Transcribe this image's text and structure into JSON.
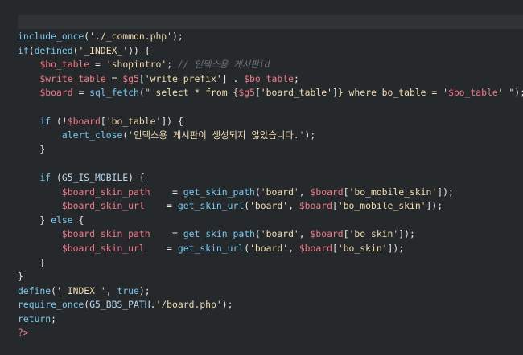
{
  "editor": {
    "lines": [
      [
        {
          "t": "include_once",
          "c": "fn"
        },
        {
          "t": "(",
          "c": "op"
        },
        {
          "t": "'./_common.php'",
          "c": "str"
        },
        {
          "t": ");",
          "c": "op"
        }
      ],
      [
        {
          "t": "if",
          "c": "kw"
        },
        {
          "t": "(",
          "c": "op"
        },
        {
          "t": "defined",
          "c": "fn"
        },
        {
          "t": "(",
          "c": "op"
        },
        {
          "t": "'_INDEX_'",
          "c": "str"
        },
        {
          "t": ")) {",
          "c": "op"
        }
      ],
      [
        {
          "t": "    ",
          "c": "op"
        },
        {
          "t": "$bo_table",
          "c": "var"
        },
        {
          "t": " = ",
          "c": "op"
        },
        {
          "t": "'shopintro'",
          "c": "str"
        },
        {
          "t": "; ",
          "c": "op"
        },
        {
          "t": "// 인덱스용 게시판id",
          "c": "cmt"
        }
      ],
      [
        {
          "t": "    ",
          "c": "op"
        },
        {
          "t": "$write_table",
          "c": "var"
        },
        {
          "t": " = ",
          "c": "op"
        },
        {
          "t": "$g5",
          "c": "var"
        },
        {
          "t": "[",
          "c": "op"
        },
        {
          "t": "'write_prefix'",
          "c": "str"
        },
        {
          "t": "] . ",
          "c": "op"
        },
        {
          "t": "$bo_table",
          "c": "var"
        },
        {
          "t": ";",
          "c": "op"
        }
      ],
      [
        {
          "t": "    ",
          "c": "op"
        },
        {
          "t": "$board",
          "c": "var"
        },
        {
          "t": " = ",
          "c": "op"
        },
        {
          "t": "sql_fetch",
          "c": "fn"
        },
        {
          "t": "(",
          "c": "op"
        },
        {
          "t": "\" select * from {",
          "c": "str"
        },
        {
          "t": "$g5",
          "c": "var"
        },
        {
          "t": "[",
          "c": "op"
        },
        {
          "t": "'board_table'",
          "c": "str"
        },
        {
          "t": "]",
          "c": "op"
        },
        {
          "t": "} where bo_table = '",
          "c": "str"
        },
        {
          "t": "$bo_table",
          "c": "var"
        },
        {
          "t": "' \"",
          "c": "str"
        },
        {
          "t": ");",
          "c": "op"
        }
      ],
      [
        {
          "t": "",
          "c": "op"
        }
      ],
      [
        {
          "t": "    ",
          "c": "op"
        },
        {
          "t": "if",
          "c": "kw"
        },
        {
          "t": " (!",
          "c": "op"
        },
        {
          "t": "$board",
          "c": "var"
        },
        {
          "t": "[",
          "c": "op"
        },
        {
          "t": "'bo_table'",
          "c": "str"
        },
        {
          "t": "]) {",
          "c": "op"
        }
      ],
      [
        {
          "t": "        ",
          "c": "op"
        },
        {
          "t": "alert_close",
          "c": "fn"
        },
        {
          "t": "(",
          "c": "op"
        },
        {
          "t": "'인덱스용 게시판이 생성되지 않았습니다.'",
          "c": "str"
        },
        {
          "t": ");",
          "c": "op"
        }
      ],
      [
        {
          "t": "    }",
          "c": "op"
        }
      ],
      [
        {
          "t": "",
          "c": "op"
        }
      ],
      [
        {
          "t": "    ",
          "c": "op"
        },
        {
          "t": "if",
          "c": "kw"
        },
        {
          "t": " (",
          "c": "op"
        },
        {
          "t": "G5_IS_MOBILE",
          "c": "const"
        },
        {
          "t": ") {",
          "c": "op"
        }
      ],
      [
        {
          "t": "        ",
          "c": "op"
        },
        {
          "t": "$board_skin_path",
          "c": "var"
        },
        {
          "t": "    = ",
          "c": "op"
        },
        {
          "t": "get_skin_path",
          "c": "fn"
        },
        {
          "t": "(",
          "c": "op"
        },
        {
          "t": "'board'",
          "c": "str"
        },
        {
          "t": ", ",
          "c": "op"
        },
        {
          "t": "$board",
          "c": "var"
        },
        {
          "t": "[",
          "c": "op"
        },
        {
          "t": "'bo_mobile_skin'",
          "c": "str"
        },
        {
          "t": "]);",
          "c": "op"
        }
      ],
      [
        {
          "t": "        ",
          "c": "op"
        },
        {
          "t": "$board_skin_url",
          "c": "var"
        },
        {
          "t": "    = ",
          "c": "op"
        },
        {
          "t": "get_skin_url",
          "c": "fn"
        },
        {
          "t": "(",
          "c": "op"
        },
        {
          "t": "'board'",
          "c": "str"
        },
        {
          "t": ", ",
          "c": "op"
        },
        {
          "t": "$board",
          "c": "var"
        },
        {
          "t": "[",
          "c": "op"
        },
        {
          "t": "'bo_mobile_skin'",
          "c": "str"
        },
        {
          "t": "]);",
          "c": "op"
        }
      ],
      [
        {
          "t": "    } ",
          "c": "op"
        },
        {
          "t": "else",
          "c": "kw"
        },
        {
          "t": " {",
          "c": "op"
        }
      ],
      [
        {
          "t": "        ",
          "c": "op"
        },
        {
          "t": "$board_skin_path",
          "c": "var"
        },
        {
          "t": "    = ",
          "c": "op"
        },
        {
          "t": "get_skin_path",
          "c": "fn"
        },
        {
          "t": "(",
          "c": "op"
        },
        {
          "t": "'board'",
          "c": "str"
        },
        {
          "t": ", ",
          "c": "op"
        },
        {
          "t": "$board",
          "c": "var"
        },
        {
          "t": "[",
          "c": "op"
        },
        {
          "t": "'bo_skin'",
          "c": "str"
        },
        {
          "t": "]);",
          "c": "op"
        }
      ],
      [
        {
          "t": "        ",
          "c": "op"
        },
        {
          "t": "$board_skin_url",
          "c": "var"
        },
        {
          "t": "    = ",
          "c": "op"
        },
        {
          "t": "get_skin_url",
          "c": "fn"
        },
        {
          "t": "(",
          "c": "op"
        },
        {
          "t": "'board'",
          "c": "str"
        },
        {
          "t": ", ",
          "c": "op"
        },
        {
          "t": "$board",
          "c": "var"
        },
        {
          "t": "[",
          "c": "op"
        },
        {
          "t": "'bo_skin'",
          "c": "str"
        },
        {
          "t": "]);",
          "c": "op"
        }
      ],
      [
        {
          "t": "    }",
          "c": "op"
        }
      ],
      [
        {
          "t": "}",
          "c": "op"
        }
      ],
      [
        {
          "t": "define",
          "c": "fn"
        },
        {
          "t": "(",
          "c": "op"
        },
        {
          "t": "'_INDEX_'",
          "c": "str"
        },
        {
          "t": ", ",
          "c": "op"
        },
        {
          "t": "true",
          "c": "kw"
        },
        {
          "t": ");",
          "c": "op"
        }
      ],
      [
        {
          "t": "require_once",
          "c": "fn"
        },
        {
          "t": "(",
          "c": "op"
        },
        {
          "t": "G5_BBS_PATH",
          "c": "const"
        },
        {
          "t": ".",
          "c": "op"
        },
        {
          "t": "'/board.php'",
          "c": "str"
        },
        {
          "t": ");",
          "c": "op"
        }
      ],
      [
        {
          "t": "return",
          "c": "kw"
        },
        {
          "t": ";",
          "c": "op"
        }
      ],
      [
        {
          "t": "?>",
          "c": "tag"
        }
      ]
    ]
  }
}
